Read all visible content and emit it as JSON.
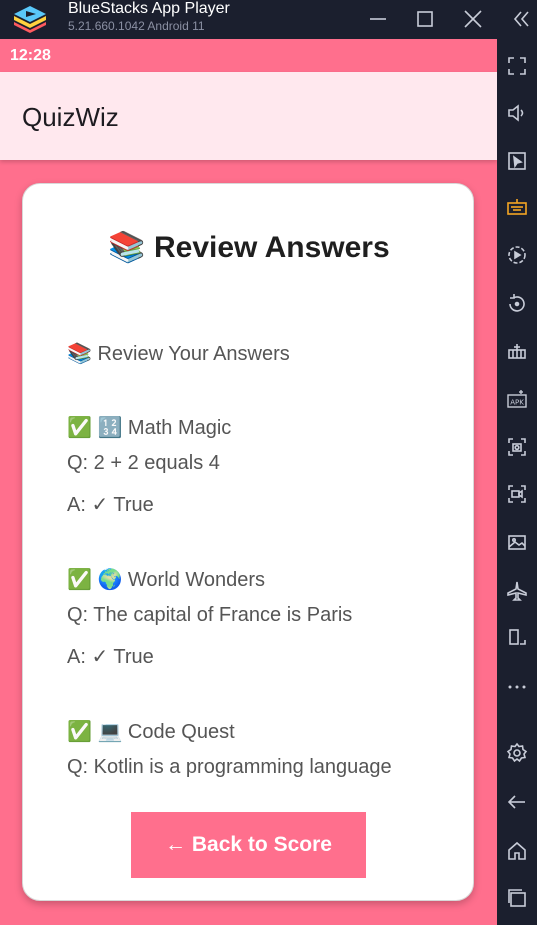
{
  "emulator": {
    "title": "BlueStacks App Player",
    "version": "5.21.660.1042  Android 11",
    "controls": [
      "minimize-icon",
      "maximize-icon",
      "close-icon",
      "collapse-sidebar-icon"
    ],
    "sidebar_icons": [
      "fullscreen-icon",
      "volume-icon",
      "cursor-icon",
      "keyboard-icon",
      "record-icon",
      "rotate-icon",
      "macro-icon",
      "apk-icon",
      "screenshot-icon",
      "screen-record-icon",
      "media-icon",
      "airplane-icon",
      "resize-icon",
      "more-icon",
      "settings-icon",
      "back-icon",
      "home-icon",
      "recents-icon"
    ]
  },
  "status_bar": {
    "time": "12:28"
  },
  "app_bar": {
    "title": "QuizWiz"
  },
  "card": {
    "heading": "📚 Review Answers",
    "subheading": "📚 Review Your Answers",
    "entries": [
      {
        "title": "✅ 🔢 Math Magic",
        "question": "Q: 2 + 2 equals 4",
        "answer": "A: ✓ True"
      },
      {
        "title": "✅ 🌍 World Wonders",
        "question": "Q: The capital of France is Paris",
        "answer": "A: ✓ True"
      },
      {
        "title": "✅ 💻 Code Quest",
        "question": "Q: Kotlin is a programming language"
      }
    ],
    "back_button": "← Back to Score"
  },
  "colors": {
    "accent": "#ff6f8d",
    "app_bar": "#ffe8ee",
    "frame": "#1b1f2e"
  }
}
